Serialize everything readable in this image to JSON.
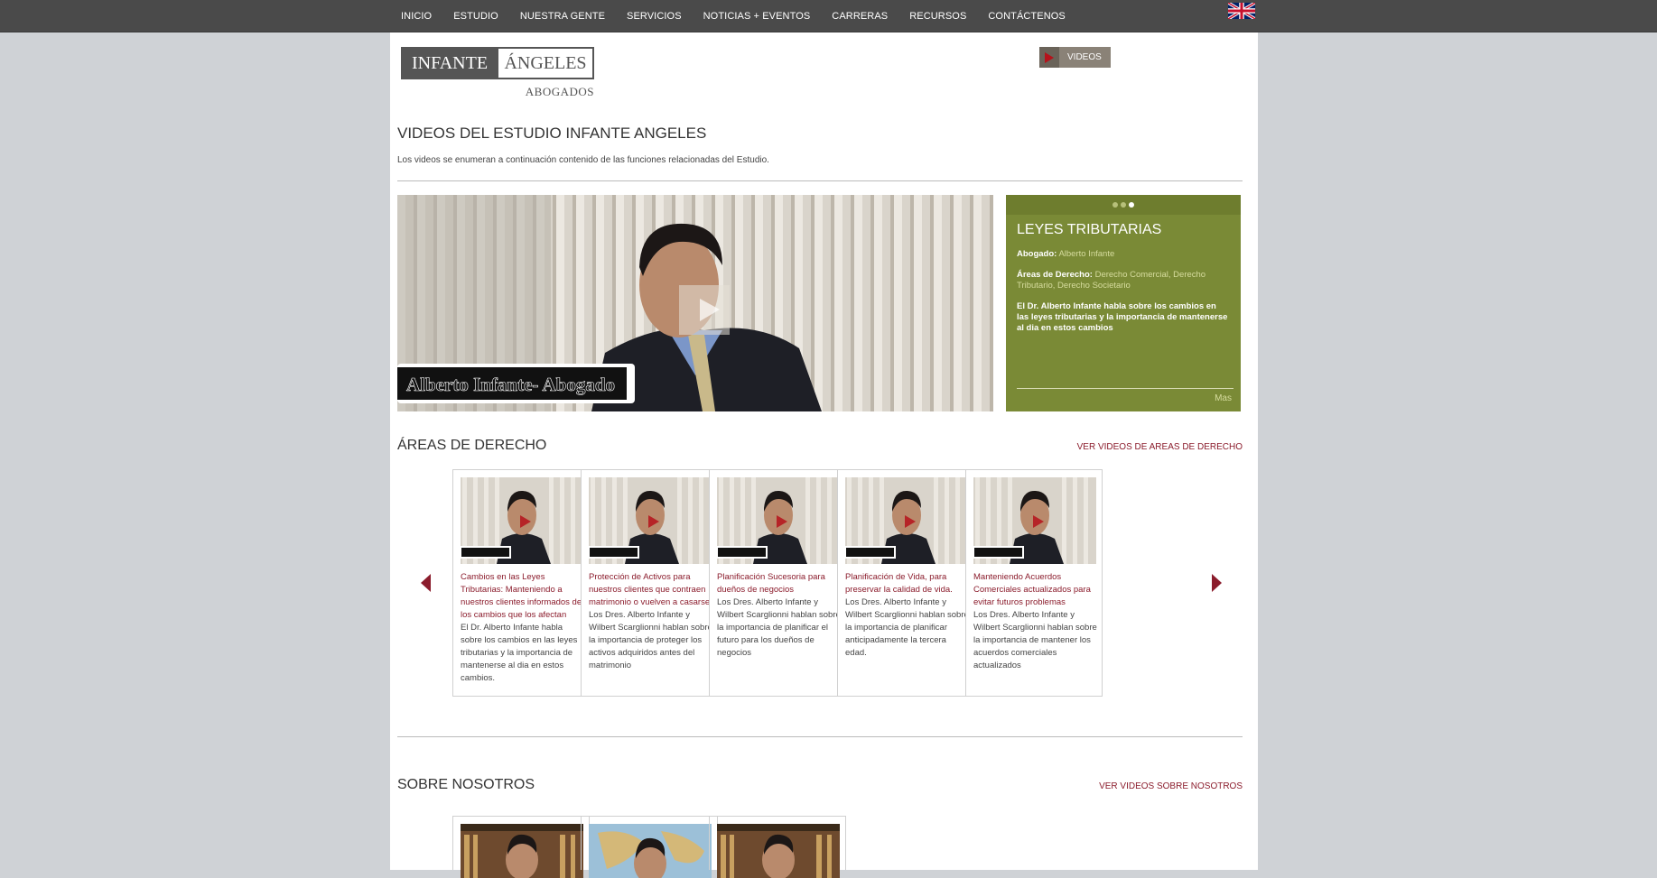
{
  "nav": {
    "items": [
      "INICIO",
      "ESTUDIO",
      "NUESTRA GENTE",
      "SERVICIOS",
      "NOTICIAS + EVENTOS",
      "CARRERAS",
      "RECURSOS",
      "CONTÁCTENOS"
    ]
  },
  "logo": {
    "left": "INFANTE",
    "right": "ÁNGELES",
    "sub": "ABOGADOS"
  },
  "videos_button": "VIDEOS",
  "page_title": "VIDEOS DEL ESTUDIO INFANTE ANGELES",
  "intro": "Los videos se enumeran a continuación contenido de las funciones relacionadas del Estudio.",
  "hero": {
    "caption": "Alberto Infante- Abogado",
    "title": "LEYES TRIBUTARIAS",
    "abogado_label": "Abogado:",
    "abogado": "Alberto Infante",
    "areas_label": "Áreas de Derecho:",
    "areas": "Derecho Comercial, Derecho Tributario, Derecho Societario",
    "desc": "El Dr. Alberto Infante habla sobre los cambios en las leyes tributarias y la importancia de mantenerse al dia en estos cambios",
    "more": "Mas",
    "slide_index": 3,
    "slide_count": 3
  },
  "areas": {
    "title": "ÁREAS DE DERECHO",
    "link": "VER VIDEOS DE AREAS DE DERECHO",
    "cards": [
      {
        "title": "Cambios en las Leyes Tributarias: Manteniendo a nuestros clientes informados de los cambios que los afectan",
        "desc": "El Dr. Alberto Infante habla sobre los cambios en las leyes tributarias y la importancia de mantenerse al dia en estos cambios."
      },
      {
        "title": "Protección de Activos para nuestros clientes que contraen matrimonio o vuelven a casarse",
        "desc": "Los Dres. Alberto Infante y Wilbert Scarglionni hablan sobre la importancia de proteger los activos adquiridos antes del matrimonio"
      },
      {
        "title": "Planificación Sucesoria para dueños de negocios",
        "desc": "Los Dres. Alberto Infante y Wilbert Scarglionni hablan sobre la importancia de planificar el futuro para los dueños de negocios"
      },
      {
        "title": "Planificación de Vida, para preservar la calidad de vida.",
        "desc": "Los Dres. Alberto Infante y Wilbert Scarglionni hablan sobre la importancia de planificar anticipadamente la tercera edad."
      },
      {
        "title": "Manteniendo Acuerdos Comerciales actualizados para evitar futuros problemas",
        "desc": "Los Dres. Alberto Infante y Wilbert Scarglionni hablan sobre la importancia de mantener los acuerdos comerciales actualizados"
      }
    ]
  },
  "about": {
    "title": "SOBRE NOSOTROS",
    "link": "VER VIDEOS SOBRE NOSOTROS"
  },
  "colors": {
    "topbar": "#4a4a4a",
    "accent_red": "#8b1c2c",
    "olive": "#7a8a36"
  }
}
